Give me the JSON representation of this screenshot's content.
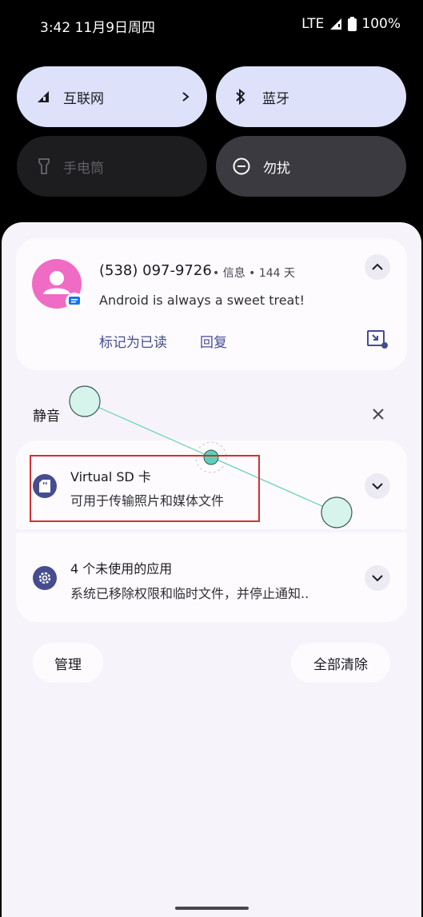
{
  "status_bar": {
    "time": "3:42 11月9日周四",
    "network": "LTE",
    "battery": "100%"
  },
  "quick_settings": {
    "internet": "互联网",
    "bluetooth": "蓝牙",
    "flashlight": "手电筒",
    "dnd": "勿扰"
  },
  "message_notification": {
    "sender": "(538) 097-9726",
    "meta": "• 信息 • 144 天",
    "text": "Android is always a sweet treat!",
    "action_mark_read": "标记为已读",
    "action_reply": "回复"
  },
  "silent_section": {
    "header": "静音"
  },
  "sd_notification": {
    "title": "Virtual SD 卡",
    "text": "可用于传输照片和媒体文件"
  },
  "unused_apps_notification": {
    "title": "4 个未使用的应用",
    "text": "系统已移除权限和临时文件，并停止通知.."
  },
  "footer": {
    "manage": "管理",
    "clear_all": "全部清除"
  },
  "colors": {
    "accent": "#454d8f",
    "tile_on": "#dde1fa",
    "highlight_box": "#d32f2f",
    "swipe_indicator": "#5fd0b8"
  }
}
